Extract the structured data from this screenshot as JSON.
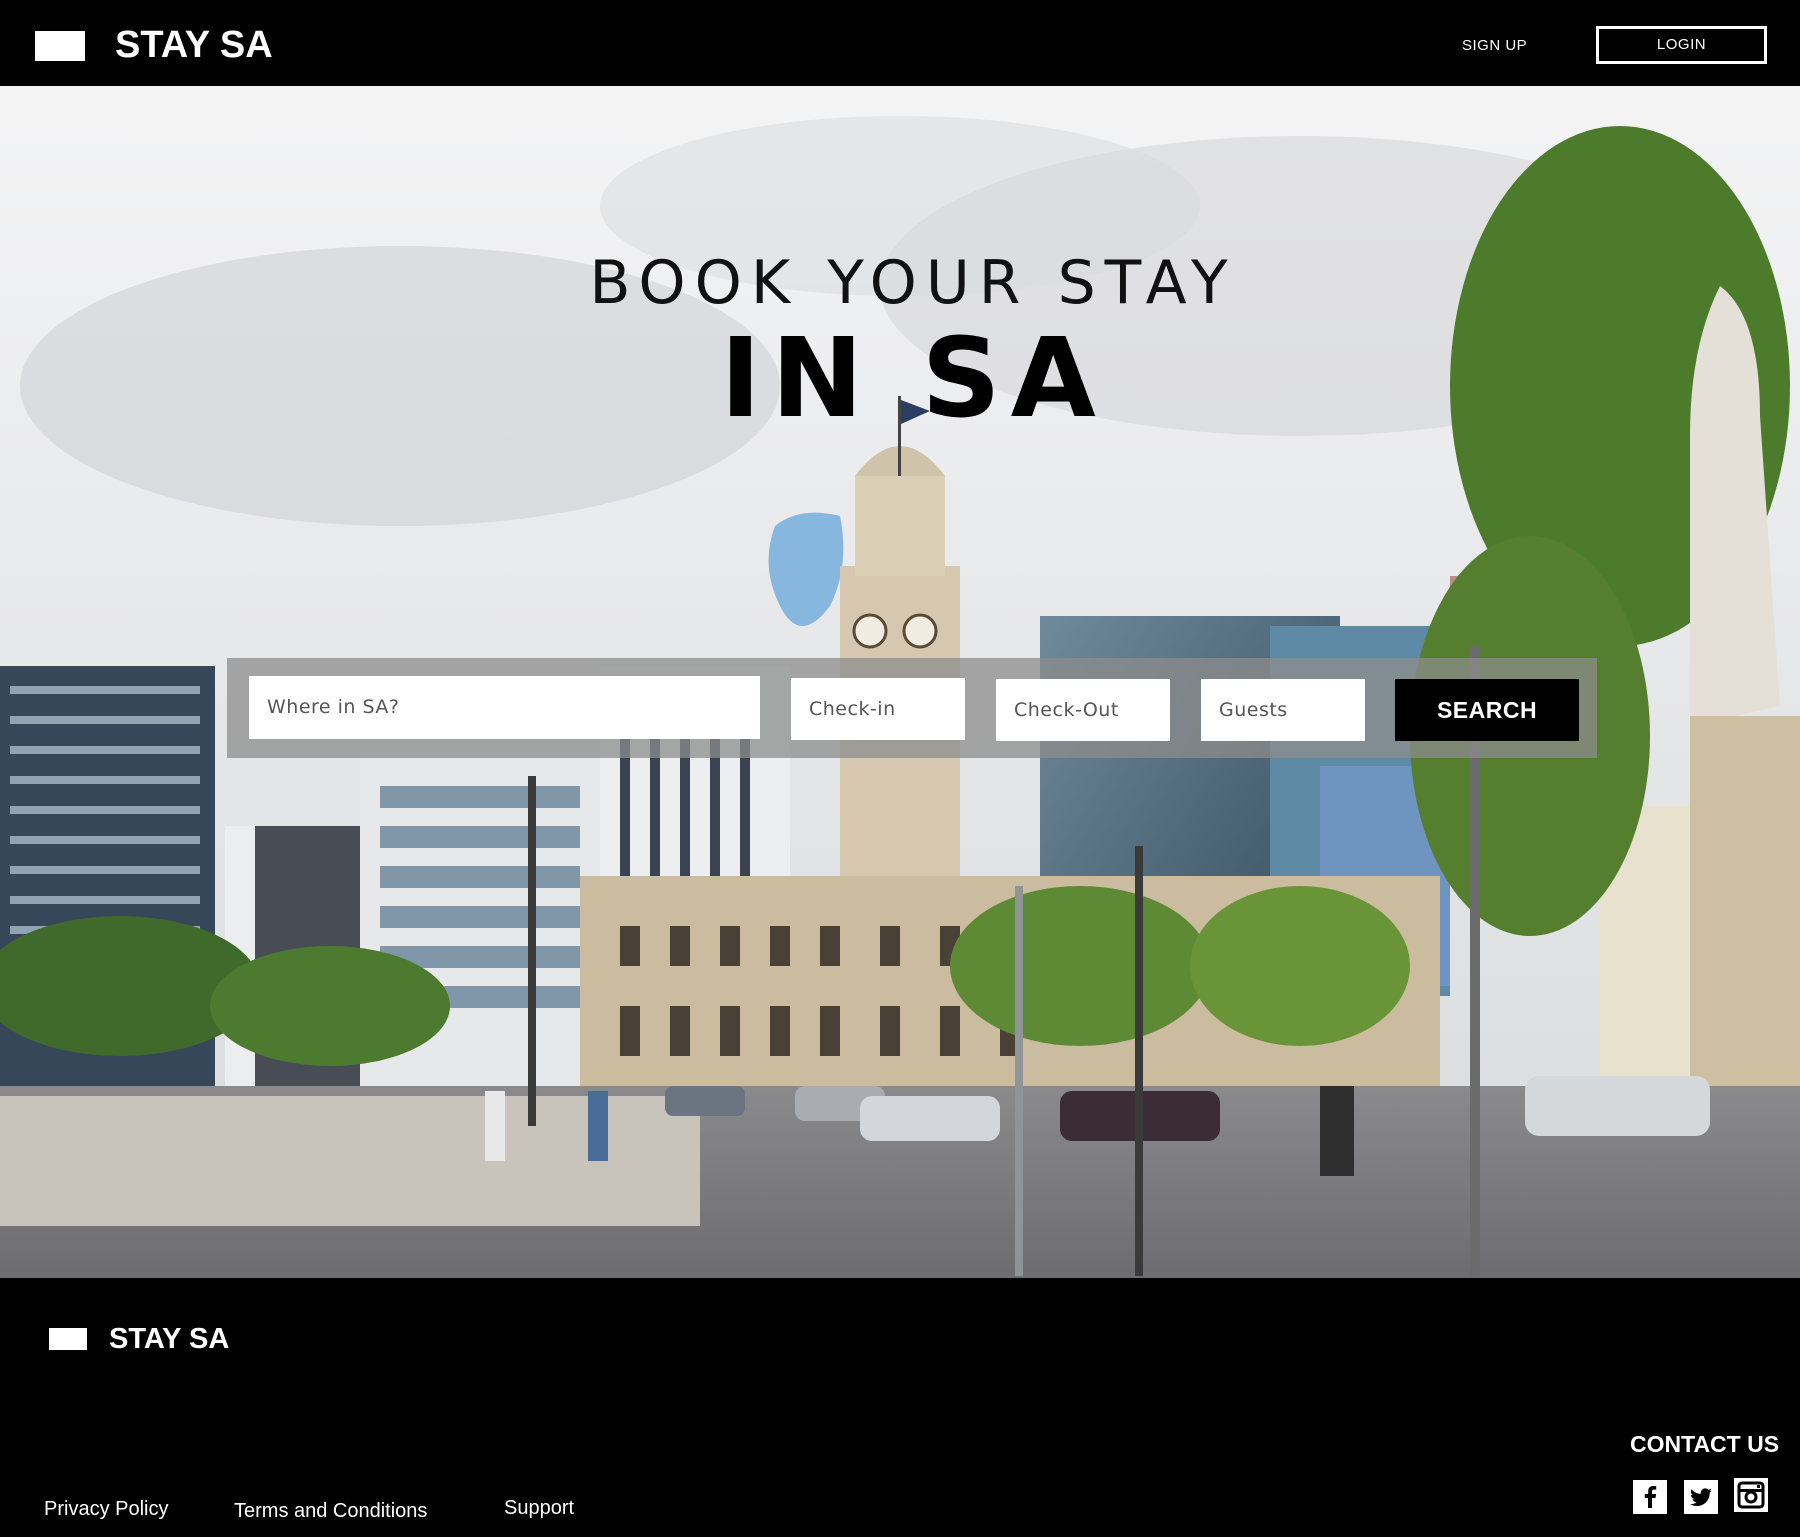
{
  "header": {
    "brand": "STAY SA",
    "signup_label": "SIGN UP",
    "login_label": "LOGIN"
  },
  "hero": {
    "line1": "BOOK YOUR STAY",
    "line2": "IN SA"
  },
  "search": {
    "where_placeholder": "Where in SA?",
    "checkin_placeholder": "Check-in",
    "checkout_placeholder": "Check-Out",
    "guests_placeholder": "Guests",
    "button_label": "SEARCH"
  },
  "footer": {
    "brand": "STAY SA",
    "contact_title": "CONTACT US",
    "links": [
      "Privacy Policy",
      "Terms and Conditions",
      "Support"
    ],
    "social": [
      "facebook-icon",
      "twitter-icon",
      "instagram-icon"
    ]
  }
}
